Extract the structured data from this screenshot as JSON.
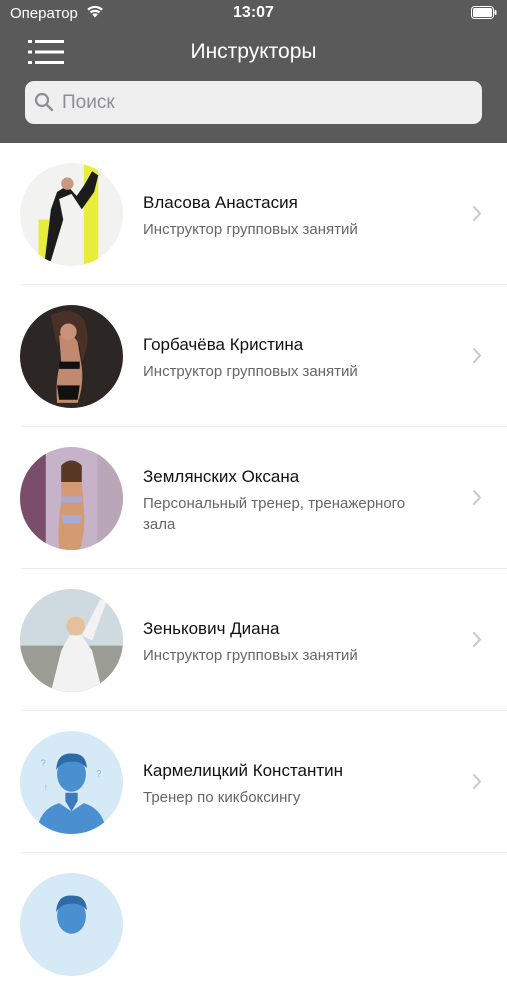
{
  "status_bar": {
    "carrier": "Оператор",
    "time": "13:07"
  },
  "header": {
    "title": "Инструкторы"
  },
  "search": {
    "placeholder": "Поиск"
  },
  "instructors": [
    {
      "name": "Власова Анастасия",
      "role": "Инструктор групповых занятий",
      "avatar": "photo"
    },
    {
      "name": "Горбачёва Кристина",
      "role": "Инструктор групповых занятий",
      "avatar": "photo"
    },
    {
      "name": "Землянских Оксана",
      "role": "Персональный тренер, тренажерного зала",
      "avatar": "photo"
    },
    {
      "name": "Зенькович Диана",
      "role": "Инструктор групповых занятий",
      "avatar": "photo"
    },
    {
      "name": "Кармелицкий Константин",
      "role": "Тренер по кикбоксингу",
      "avatar": "placeholder-person-icon"
    }
  ],
  "colors": {
    "header_bg": "#5a5a5a",
    "search_bg": "#efefef",
    "placeholder_avatar_bg": "#d6e9f7",
    "placeholder_avatar_fg": "#4a8fd0"
  }
}
